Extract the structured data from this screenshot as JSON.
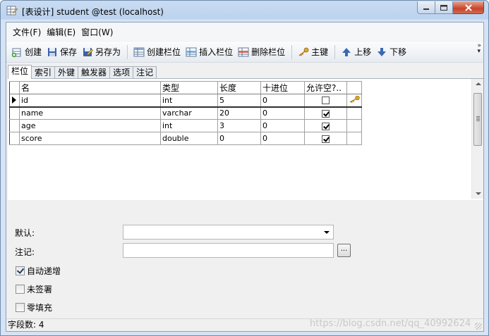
{
  "window": {
    "title": "[表设计] student @test (localhost)",
    "icon": "table-design-icon"
  },
  "menu": {
    "items": [
      {
        "label": "文件(F)"
      },
      {
        "label": "编辑(E)"
      },
      {
        "label": "窗口(W)"
      }
    ]
  },
  "toolbar": {
    "create": "创建",
    "save": "保存",
    "save_as": "另存为",
    "create_field": "创建栏位",
    "insert_field": "插入栏位",
    "delete_field": "删除栏位",
    "primary_key": "主键",
    "move_up": "上移",
    "move_down": "下移"
  },
  "tabs": [
    {
      "label": "栏位",
      "active": true
    },
    {
      "label": "索引"
    },
    {
      "label": "外键"
    },
    {
      "label": "触发器"
    },
    {
      "label": "选项"
    },
    {
      "label": "注记"
    }
  ],
  "grid": {
    "headers": {
      "name": "名",
      "type": "类型",
      "length": "长度",
      "decimals": "十进位",
      "allow_null": "允许空?.."
    },
    "rows": [
      {
        "name": "id",
        "type": "int",
        "length": "5",
        "decimals": "0",
        "allow_null": false,
        "primary_key": true,
        "current": true
      },
      {
        "name": "name",
        "type": "varchar",
        "length": "20",
        "decimals": "0",
        "allow_null": true,
        "primary_key": false
      },
      {
        "name": "age",
        "type": "int",
        "length": "3",
        "decimals": "0",
        "allow_null": true,
        "primary_key": false
      },
      {
        "name": "score",
        "type": "double",
        "length": "0",
        "decimals": "0",
        "allow_null": true,
        "primary_key": false
      }
    ]
  },
  "properties": {
    "default_label": "默认:",
    "default_value": "",
    "comment_label": "注记:",
    "comment_value": "",
    "ellipsis": "...",
    "auto_increment_label": "自动递增",
    "auto_increment": true,
    "unsigned_label": "未签署",
    "unsigned": false,
    "zerofill_label": "零填充",
    "zerofill": false
  },
  "status": {
    "field_count": "字段数: 4"
  },
  "watermark": "https://blog.csdn.net/qq_40992624",
  "colors": {
    "title_bar": "#bcd2ee",
    "close_button": "#c7442a",
    "key_icon": "#d4a017"
  }
}
